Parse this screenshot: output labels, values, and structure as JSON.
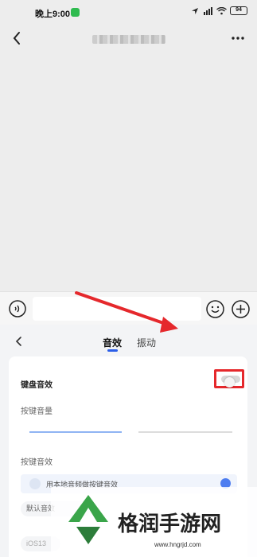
{
  "status_bar": {
    "time": "晚上9:00",
    "battery": "94"
  },
  "nav": {
    "title_blurred": true
  },
  "panel": {
    "tabs": [
      {
        "label": "音效",
        "active": true
      },
      {
        "label": "振动",
        "active": false
      }
    ],
    "keyboard_sound": {
      "label": "键盘音效",
      "enabled": false
    },
    "volume": {
      "label": "按键音量"
    },
    "key_sound": {
      "label": "按键音效",
      "local_audio_label": "用本地音频做按键音效"
    },
    "chips": {
      "default": "默认音效",
      "ios": "iOS13"
    }
  },
  "watermark": {
    "brand": "格润手游网",
    "url": "www.hngrjd.com"
  },
  "colors": {
    "accent": "#2b5ee8",
    "highlight": "#e5282c",
    "wechat": "#2fbb4f"
  }
}
